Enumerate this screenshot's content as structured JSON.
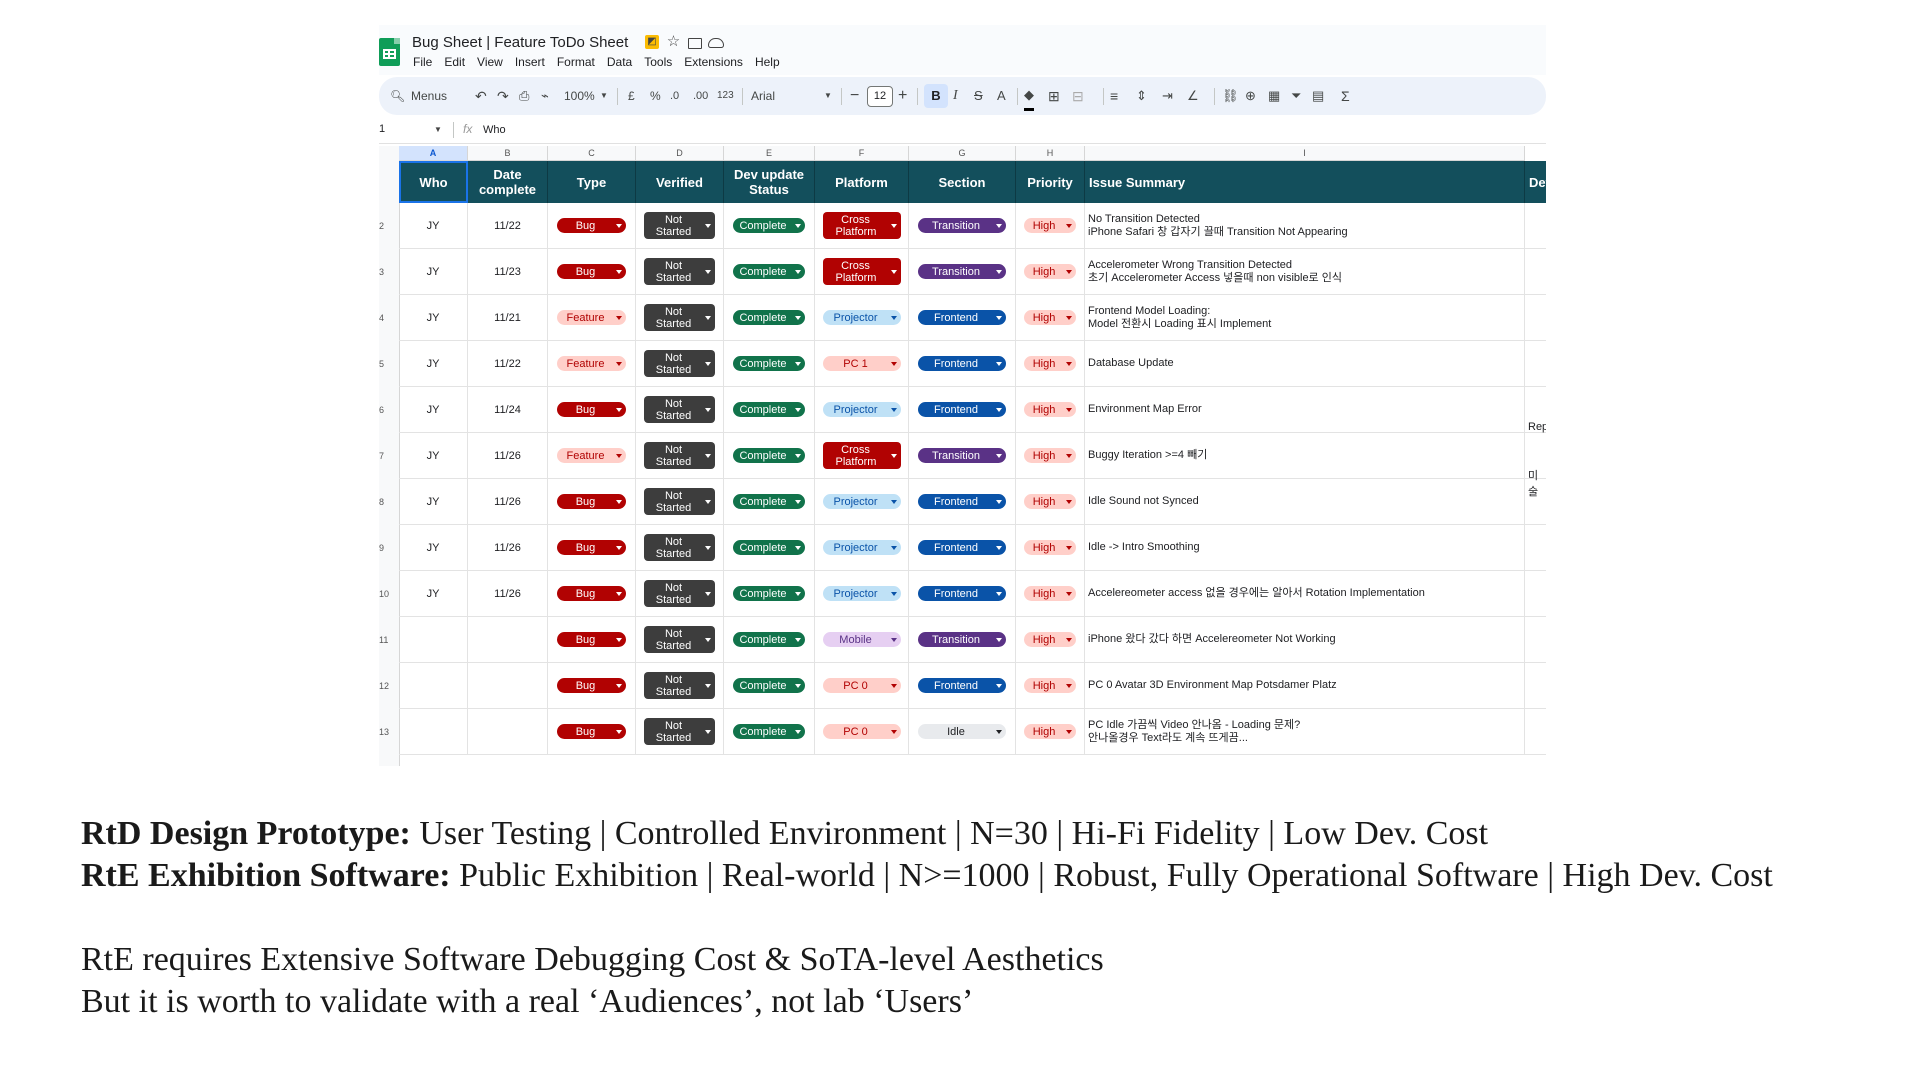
{
  "window": {
    "doc_title": "Bug Sheet | Feature ToDo Sheet",
    "menus": [
      "File",
      "Edit",
      "View",
      "Insert",
      "Format",
      "Data",
      "Tools",
      "Extensions",
      "Help"
    ]
  },
  "toolbar": {
    "search_label": "Menus",
    "zoom": "100%",
    "currency": "£",
    "percent": "%",
    "dec_less": ".0",
    "dec_more": ".00",
    "number_format": "123",
    "font": "Arial",
    "font_size": "12",
    "bold": "B",
    "italic": "I",
    "strike": "S",
    "text_color": "A",
    "sigma": "Σ"
  },
  "formula_bar": {
    "name_box": "1",
    "fx": "fx",
    "value": "Who"
  },
  "columns": [
    "A",
    "B",
    "C",
    "D",
    "E",
    "F",
    "G",
    "H",
    "I"
  ],
  "headers": {
    "who": "Who",
    "date": "Date complete",
    "type": "Type",
    "verified": "Verified",
    "dev": "Dev update Status",
    "platform": "Platform",
    "section": "Section",
    "priority": "Priority",
    "summary": "Issue Summary",
    "details": "Det"
  },
  "row_numbers": [
    "2",
    "3",
    "4",
    "5",
    "6",
    "7",
    "8",
    "9",
    "10",
    "11",
    "12",
    "13"
  ],
  "rows": [
    {
      "who": "JY",
      "date": "11/22",
      "type": "Bug",
      "verified": "Not Started",
      "dev": "Complete",
      "platform": "Cross Platform",
      "section": "Transition",
      "priority": "High",
      "summary1": "No Transition Detected",
      "summary2": "iPhone Safari 창 갑자기 끌때 Transition Not Appearing"
    },
    {
      "who": "JY",
      "date": "11/23",
      "type": "Bug",
      "verified": "Not Started",
      "dev": "Complete",
      "platform": "Cross Platform",
      "section": "Transition",
      "priority": "High",
      "summary1": "Accelerometer Wrong Transition Detected",
      "summary2": "초기 Accelerometer Access 넣을때 non visible로 인식"
    },
    {
      "who": "JY",
      "date": "11/21",
      "type": "Feature",
      "verified": "Not Started",
      "dev": "Complete",
      "platform": "Projector",
      "section": "Frontend",
      "priority": "High",
      "summary1": "Frontend Model Loading:",
      "summary2": "Model 전환시 Loading 표시 Implement"
    },
    {
      "who": "JY",
      "date": "11/22",
      "type": "Feature",
      "verified": "Not Started",
      "dev": "Complete",
      "platform": "PC 1",
      "section": "Frontend",
      "priority": "High",
      "summary1": "Database Update",
      "summary2": ""
    },
    {
      "who": "JY",
      "date": "11/24",
      "type": "Bug",
      "verified": "Not Started",
      "dev": "Complete",
      "platform": "Projector",
      "section": "Frontend",
      "priority": "High",
      "summary1": "Environment Map Error",
      "summary2": ""
    },
    {
      "who": "JY",
      "date": "11/26",
      "type": "Feature",
      "verified": "Not Started",
      "dev": "Complete",
      "platform": "Cross Platform",
      "section": "Transition",
      "priority": "High",
      "summary1": "Buggy Iteration >=4 빼기",
      "summary2": ""
    },
    {
      "who": "JY",
      "date": "11/26",
      "type": "Bug",
      "verified": "Not Started",
      "dev": "Complete",
      "platform": "Projector",
      "section": "Frontend",
      "priority": "High",
      "summary1": "Idle Sound not Synced",
      "summary2": ""
    },
    {
      "who": "JY",
      "date": "11/26",
      "type": "Bug",
      "verified": "Not Started",
      "dev": "Complete",
      "platform": "Projector",
      "section": "Frontend",
      "priority": "High",
      "summary1": "Idle -> Intro Smoothing",
      "summary2": ""
    },
    {
      "who": "JY",
      "date": "11/26",
      "type": "Bug",
      "verified": "Not Started",
      "dev": "Complete",
      "platform": "Projector",
      "section": "Frontend",
      "priority": "High",
      "summary1": "Accelereometer access 없을 경우에는 알아서 Rotation Implementation",
      "summary2": ""
    },
    {
      "who": "",
      "date": "",
      "type": "Bug",
      "verified": "Not Started",
      "dev": "Complete",
      "platform": "Mobile",
      "section": "Transition",
      "priority": "High",
      "summary1": "iPhone 왔다 갔다 하면 Accelereometer Not Working",
      "summary2": ""
    },
    {
      "who": "",
      "date": "",
      "type": "Bug",
      "verified": "Not Started",
      "dev": "Complete",
      "platform": "PC 0",
      "section": "Frontend",
      "priority": "High",
      "summary1": "PC 0 Avatar 3D Environment Map Potsdamer Platz",
      "summary2": ""
    },
    {
      "who": "",
      "date": "",
      "type": "Bug",
      "verified": "Not Started",
      "dev": "Complete",
      "platform": "PC 0",
      "section": "Idle",
      "priority": "High",
      "summary1": "PC Idle 가끔씩 Video 안나옴 - Loading 문제?",
      "summary2": "안나올경우 Text라도 계속 뜨게끔..."
    }
  ],
  "side_texts": {
    "rep": "Rep",
    "misul": "미술"
  },
  "caption": {
    "line1_bold": "RtD Design Prototype:",
    "line1_rest": " User Testing | Controlled Environment | N=30 | Hi-Fi Fidelity | Low Dev. Cost",
    "line2_bold": "RtE Exhibition Software:",
    "line2_rest": " Public Exhibition | Real-world | N>=1000 | Robust, Fully Operational Software | High Dev. Cost",
    "line3": "RtE requires Extensive Software Debugging Cost & SoTA-level Aesthetics",
    "line4": "But it is worth to validate with a real ‘Audiences’, not lab ‘Users’"
  }
}
